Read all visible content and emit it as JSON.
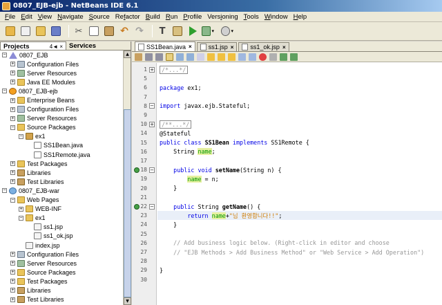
{
  "window": {
    "title": "0807_EJB-ejb - NetBeans IDE 6.1"
  },
  "menu": [
    {
      "label": "File",
      "u": "F"
    },
    {
      "label": "Edit",
      "u": "E"
    },
    {
      "label": "View",
      "u": "V"
    },
    {
      "label": "Navigate",
      "u": "N"
    },
    {
      "label": "Source",
      "u": "S"
    },
    {
      "label": "Refactor",
      "u": "f"
    },
    {
      "label": "Build",
      "u": "B"
    },
    {
      "label": "Run",
      "u": "R"
    },
    {
      "label": "Profile",
      "u": "P"
    },
    {
      "label": "Versioning",
      "u": "i"
    },
    {
      "label": "Tools",
      "u": "T"
    },
    {
      "label": "Window",
      "u": "W"
    },
    {
      "label": "Help",
      "u": "H"
    }
  ],
  "panel": {
    "tab_projects": "Projects",
    "tab_controls": "4◄ ×",
    "tab_services": "Services"
  },
  "tree": [
    {
      "depth": 0,
      "exp": "-",
      "icon": "proj-ejb",
      "label": "0807_EJB"
    },
    {
      "depth": 1,
      "exp": "+",
      "icon": "gear",
      "label": "Configuration Files"
    },
    {
      "depth": 1,
      "exp": "+",
      "icon": "server",
      "label": "Server Resources"
    },
    {
      "depth": 1,
      "exp": "+",
      "icon": "folder",
      "label": "Java EE Modules"
    },
    {
      "depth": 0,
      "exp": "-",
      "icon": "project",
      "label": "0807_EJB-ejb"
    },
    {
      "depth": 1,
      "exp": "+",
      "icon": "folder",
      "label": "Enterprise Beans"
    },
    {
      "depth": 1,
      "exp": "+",
      "icon": "gear",
      "label": "Configuration Files"
    },
    {
      "depth": 1,
      "exp": "+",
      "icon": "server",
      "label": "Server Resources"
    },
    {
      "depth": 1,
      "exp": "-",
      "icon": "folder",
      "label": "Source Packages"
    },
    {
      "depth": 2,
      "exp": "-",
      "icon": "pkg",
      "label": "ex1"
    },
    {
      "depth": 3,
      "exp": "",
      "icon": "java",
      "label": "SS1Bean.java"
    },
    {
      "depth": 3,
      "exp": "",
      "icon": "java",
      "label": "SS1Remote.java"
    },
    {
      "depth": 1,
      "exp": "+",
      "icon": "folder",
      "label": "Test Packages"
    },
    {
      "depth": 1,
      "exp": "+",
      "icon": "lib",
      "label": "Libraries"
    },
    {
      "depth": 1,
      "exp": "+",
      "icon": "lib",
      "label": "Test Libraries"
    },
    {
      "depth": 0,
      "exp": "-",
      "icon": "globe",
      "label": "0807_EJB-war"
    },
    {
      "depth": 1,
      "exp": "-",
      "icon": "folder",
      "label": "Web Pages"
    },
    {
      "depth": 2,
      "exp": "+",
      "icon": "folder",
      "label": "WEB-INF"
    },
    {
      "depth": 2,
      "exp": "-",
      "icon": "folder",
      "label": "ex1"
    },
    {
      "depth": 3,
      "exp": "",
      "icon": "jsp",
      "label": "ss1.jsp"
    },
    {
      "depth": 3,
      "exp": "",
      "icon": "jsp",
      "label": "ss1_ok.jsp"
    },
    {
      "depth": 2,
      "exp": "",
      "icon": "jsp",
      "label": "index.jsp"
    },
    {
      "depth": 1,
      "exp": "+",
      "icon": "gear",
      "label": "Configuration Files"
    },
    {
      "depth": 1,
      "exp": "+",
      "icon": "server",
      "label": "Server Resources"
    },
    {
      "depth": 1,
      "exp": "+",
      "icon": "folder",
      "label": "Source Packages"
    },
    {
      "depth": 1,
      "exp": "+",
      "icon": "folder",
      "label": "Test Packages"
    },
    {
      "depth": 1,
      "exp": "+",
      "icon": "lib",
      "label": "Libraries"
    },
    {
      "depth": 1,
      "exp": "+",
      "icon": "lib",
      "label": "Test Libraries"
    }
  ],
  "editor_tabs": [
    {
      "label": "SS1Bean.java",
      "active": true
    },
    {
      "label": "ss1.jsp",
      "active": false
    },
    {
      "label": "ss1_ok.jsp",
      "active": false
    }
  ],
  "code": [
    {
      "n": "1",
      "fold": "+",
      "ann": false,
      "cur": false,
      "segs": [
        {
          "t": "/*...*/",
          "c": "cm boxed"
        }
      ]
    },
    {
      "n": "5",
      "fold": "",
      "ann": false,
      "cur": false,
      "segs": []
    },
    {
      "n": "6",
      "fold": "",
      "ann": false,
      "cur": false,
      "segs": [
        {
          "t": "package",
          "c": "kw"
        },
        {
          "t": " ex1;",
          "c": ""
        }
      ]
    },
    {
      "n": "7",
      "fold": "",
      "ann": false,
      "cur": false,
      "segs": []
    },
    {
      "n": "8",
      "fold": "-",
      "ann": false,
      "cur": false,
      "segs": [
        {
          "t": "import",
          "c": "kw"
        },
        {
          "t": " javax.ejb.Stateful;",
          "c": ""
        }
      ]
    },
    {
      "n": "9",
      "fold": "",
      "ann": false,
      "cur": false,
      "segs": []
    },
    {
      "n": "10",
      "fold": "+",
      "ann": false,
      "cur": false,
      "segs": [
        {
          "t": "/**...*/",
          "c": "cm boxed"
        }
      ]
    },
    {
      "n": "14",
      "fold": "",
      "ann": false,
      "cur": false,
      "segs": [
        {
          "t": "@Stateful",
          "c": ""
        }
      ]
    },
    {
      "n": "15",
      "fold": "",
      "ann": false,
      "cur": false,
      "segs": [
        {
          "t": "public class",
          "c": "kw"
        },
        {
          "t": " ",
          "c": ""
        },
        {
          "t": "SS1Bean",
          "c": "bold"
        },
        {
          "t": " ",
          "c": ""
        },
        {
          "t": "implements",
          "c": "kw"
        },
        {
          "t": " SS1Remote {",
          "c": ""
        }
      ]
    },
    {
      "n": "16",
      "fold": "",
      "ann": false,
      "cur": false,
      "segs": [
        {
          "t": "    String ",
          "c": ""
        },
        {
          "t": "name",
          "c": "fieldhl"
        },
        {
          "t": ";",
          "c": ""
        }
      ]
    },
    {
      "n": "17",
      "fold": "",
      "ann": false,
      "cur": false,
      "segs": []
    },
    {
      "n": "18",
      "fold": "-",
      "ann": true,
      "cur": false,
      "segs": [
        {
          "t": "    ",
          "c": ""
        },
        {
          "t": "public void",
          "c": "kw"
        },
        {
          "t": " ",
          "c": ""
        },
        {
          "t": "setName",
          "c": "bold"
        },
        {
          "t": "(String n) {",
          "c": ""
        }
      ]
    },
    {
      "n": "19",
      "fold": "",
      "ann": false,
      "cur": false,
      "segs": [
        {
          "t": "        ",
          "c": ""
        },
        {
          "t": "name",
          "c": "fieldhl"
        },
        {
          "t": " = n;",
          "c": ""
        }
      ]
    },
    {
      "n": "20",
      "fold": "",
      "ann": false,
      "cur": false,
      "segs": [
        {
          "t": "    }",
          "c": ""
        }
      ]
    },
    {
      "n": "21",
      "fold": "",
      "ann": false,
      "cur": false,
      "segs": []
    },
    {
      "n": "22",
      "fold": "-",
      "ann": true,
      "cur": false,
      "segs": [
        {
          "t": "    ",
          "c": ""
        },
        {
          "t": "public",
          "c": "kw"
        },
        {
          "t": " String ",
          "c": ""
        },
        {
          "t": "getName",
          "c": "bold"
        },
        {
          "t": "() {",
          "c": ""
        }
      ]
    },
    {
      "n": "23",
      "fold": "",
      "ann": false,
      "cur": true,
      "segs": [
        {
          "t": "        ",
          "c": ""
        },
        {
          "t": "return",
          "c": "kw"
        },
        {
          "t": " ",
          "c": ""
        },
        {
          "t": "name",
          "c": "fieldhl"
        },
        {
          "t": "+",
          "c": ""
        },
        {
          "t": "\"님 환영합니다!!\"",
          "c": "str"
        },
        {
          "t": ";",
          "c": ""
        }
      ]
    },
    {
      "n": "24",
      "fold": "",
      "ann": false,
      "cur": false,
      "segs": [
        {
          "t": "    }",
          "c": ""
        }
      ]
    },
    {
      "n": "25",
      "fold": "",
      "ann": false,
      "cur": false,
      "segs": []
    },
    {
      "n": "26",
      "fold": "",
      "ann": false,
      "cur": false,
      "segs": [
        {
          "t": "    // Add business logic below. (Right-click in editor and choose",
          "c": "cm"
        }
      ]
    },
    {
      "n": "27",
      "fold": "",
      "ann": false,
      "cur": false,
      "segs": [
        {
          "t": "    // \"EJB Methods > Add Business Method\" or \"Web Service > Add Operation\")",
          "c": "cm"
        }
      ]
    },
    {
      "n": "28",
      "fold": "",
      "ann": false,
      "cur": false,
      "segs": []
    },
    {
      "n": "29",
      "fold": "",
      "ann": false,
      "cur": false,
      "segs": [
        {
          "t": "}",
          "c": ""
        }
      ]
    },
    {
      "n": "30",
      "fold": "",
      "ann": false,
      "cur": false,
      "segs": []
    }
  ],
  "colors": {
    "title_bar": "#0a246a",
    "keyword": "#0000e6",
    "comment": "#969696",
    "string": "#ce7b00",
    "field": "#009900"
  }
}
